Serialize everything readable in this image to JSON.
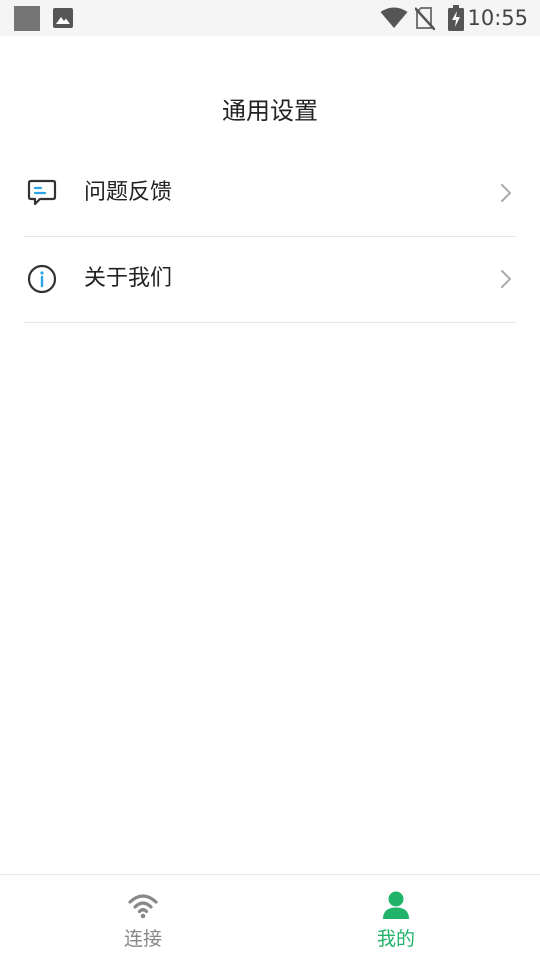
{
  "status_bar": {
    "time": "10:55"
  },
  "page": {
    "title": "通用设置"
  },
  "menu": [
    {
      "label": "问题反馈",
      "icon": "feedback-icon"
    },
    {
      "label": "关于我们",
      "icon": "info-icon"
    }
  ],
  "tabbar": {
    "tabs": [
      {
        "label": "连接",
        "icon": "wifi-icon",
        "active": false
      },
      {
        "label": "我的",
        "icon": "user-icon",
        "active": true
      }
    ],
    "active_color": "#21b36a",
    "inactive_color": "#888888"
  }
}
